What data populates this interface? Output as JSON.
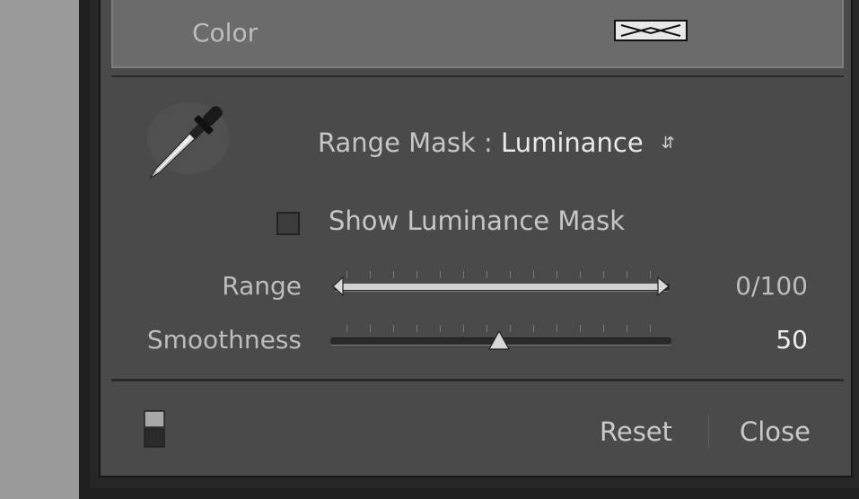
{
  "color_row": {
    "label": "Color",
    "swatch_state": "none"
  },
  "mask": {
    "prefix": "Range Mask : ",
    "value": "Luminance",
    "spinner_icon": "up-down-spinner-icon"
  },
  "show_mask": {
    "label": "Show Luminance Mask",
    "checked": false
  },
  "sliders": {
    "range": {
      "label": "Range",
      "value_text": "0/100",
      "low": 0,
      "high": 100
    },
    "smoothness": {
      "label": "Smoothness",
      "value_text": "50",
      "value": 50
    }
  },
  "footer": {
    "toggle_icon": "panel-toggle-icon",
    "reset_label": "Reset",
    "close_label": "Close"
  },
  "colors": {
    "panel_bg": "#4a4a4a",
    "color_row_bg": "#6b6b6b",
    "text": "#c6c6c6",
    "value_highlight": "#f0f0f0",
    "range_fill": "#d2d2d2"
  }
}
